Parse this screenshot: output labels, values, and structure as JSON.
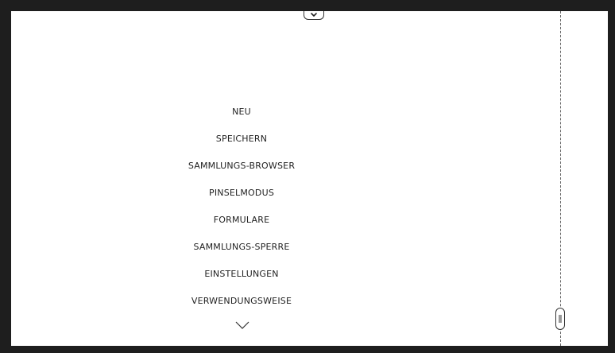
{
  "menu": {
    "items": [
      {
        "label": "NEU"
      },
      {
        "label": "SPEICHERN"
      },
      {
        "label": "SAMMLUNGS-BROWSER"
      },
      {
        "label": "PINSELMODUS"
      },
      {
        "label": "FORMULARE"
      },
      {
        "label": "SAMMLUNGS-SPERRE"
      },
      {
        "label": "EINSTELLUNGEN"
      },
      {
        "label": "VERWENDUNGSWEISE"
      }
    ],
    "more_icon": "chevron-down-icon"
  },
  "top_handle": {
    "icon": "chevron-down-icon"
  },
  "scroll_handle": {
    "icon": "grip-icon"
  },
  "colors": {
    "bezel": "#1e1e1e",
    "canvas": "#ffffff",
    "text": "#222222",
    "divider": "#666666"
  }
}
